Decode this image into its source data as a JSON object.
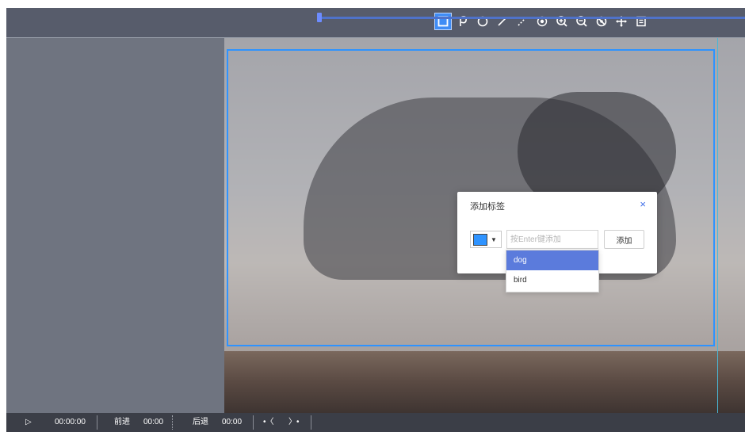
{
  "toolbar": {
    "tools": [
      {
        "name": "rectangle-tool",
        "icon": "rectangle-icon",
        "active": true
      },
      {
        "name": "lasso-tool",
        "icon": "lasso-icon"
      },
      {
        "name": "circle-tool",
        "icon": "circle-icon"
      },
      {
        "name": "line-tool",
        "icon": "line-icon"
      },
      {
        "name": "dashed-line-tool",
        "icon": "dashed-line-icon"
      },
      {
        "name": "point-tool",
        "icon": "point-icon"
      },
      {
        "name": "zoom-in-tool",
        "icon": "zoom-in-icon"
      },
      {
        "name": "zoom-out-tool",
        "icon": "zoom-out-icon"
      },
      {
        "name": "hide-tool",
        "icon": "eye-off-icon"
      },
      {
        "name": "move-tool",
        "icon": "move-icon"
      },
      {
        "name": "fit-tool",
        "icon": "fit-screen-icon"
      }
    ],
    "accent": "#3f8cf5"
  },
  "dialog": {
    "title": "添加标签",
    "close": "×",
    "color": "#2e93ff",
    "color_caret": "▼",
    "input_placeholder": "按Enter键添加",
    "input_value": "",
    "add_label": "添加",
    "suggestions": [
      {
        "label": "dog",
        "highlighted": true
      },
      {
        "label": "bird",
        "highlighted": false
      }
    ]
  },
  "controls": {
    "play": "▷",
    "time": "00:00:00",
    "forward_label": "前进",
    "forward_time": "00:00",
    "back_label": "后退",
    "back_time": "00:00",
    "prev_frame": "•〈",
    "next_frame": "〉•",
    "progress": 0.0
  }
}
